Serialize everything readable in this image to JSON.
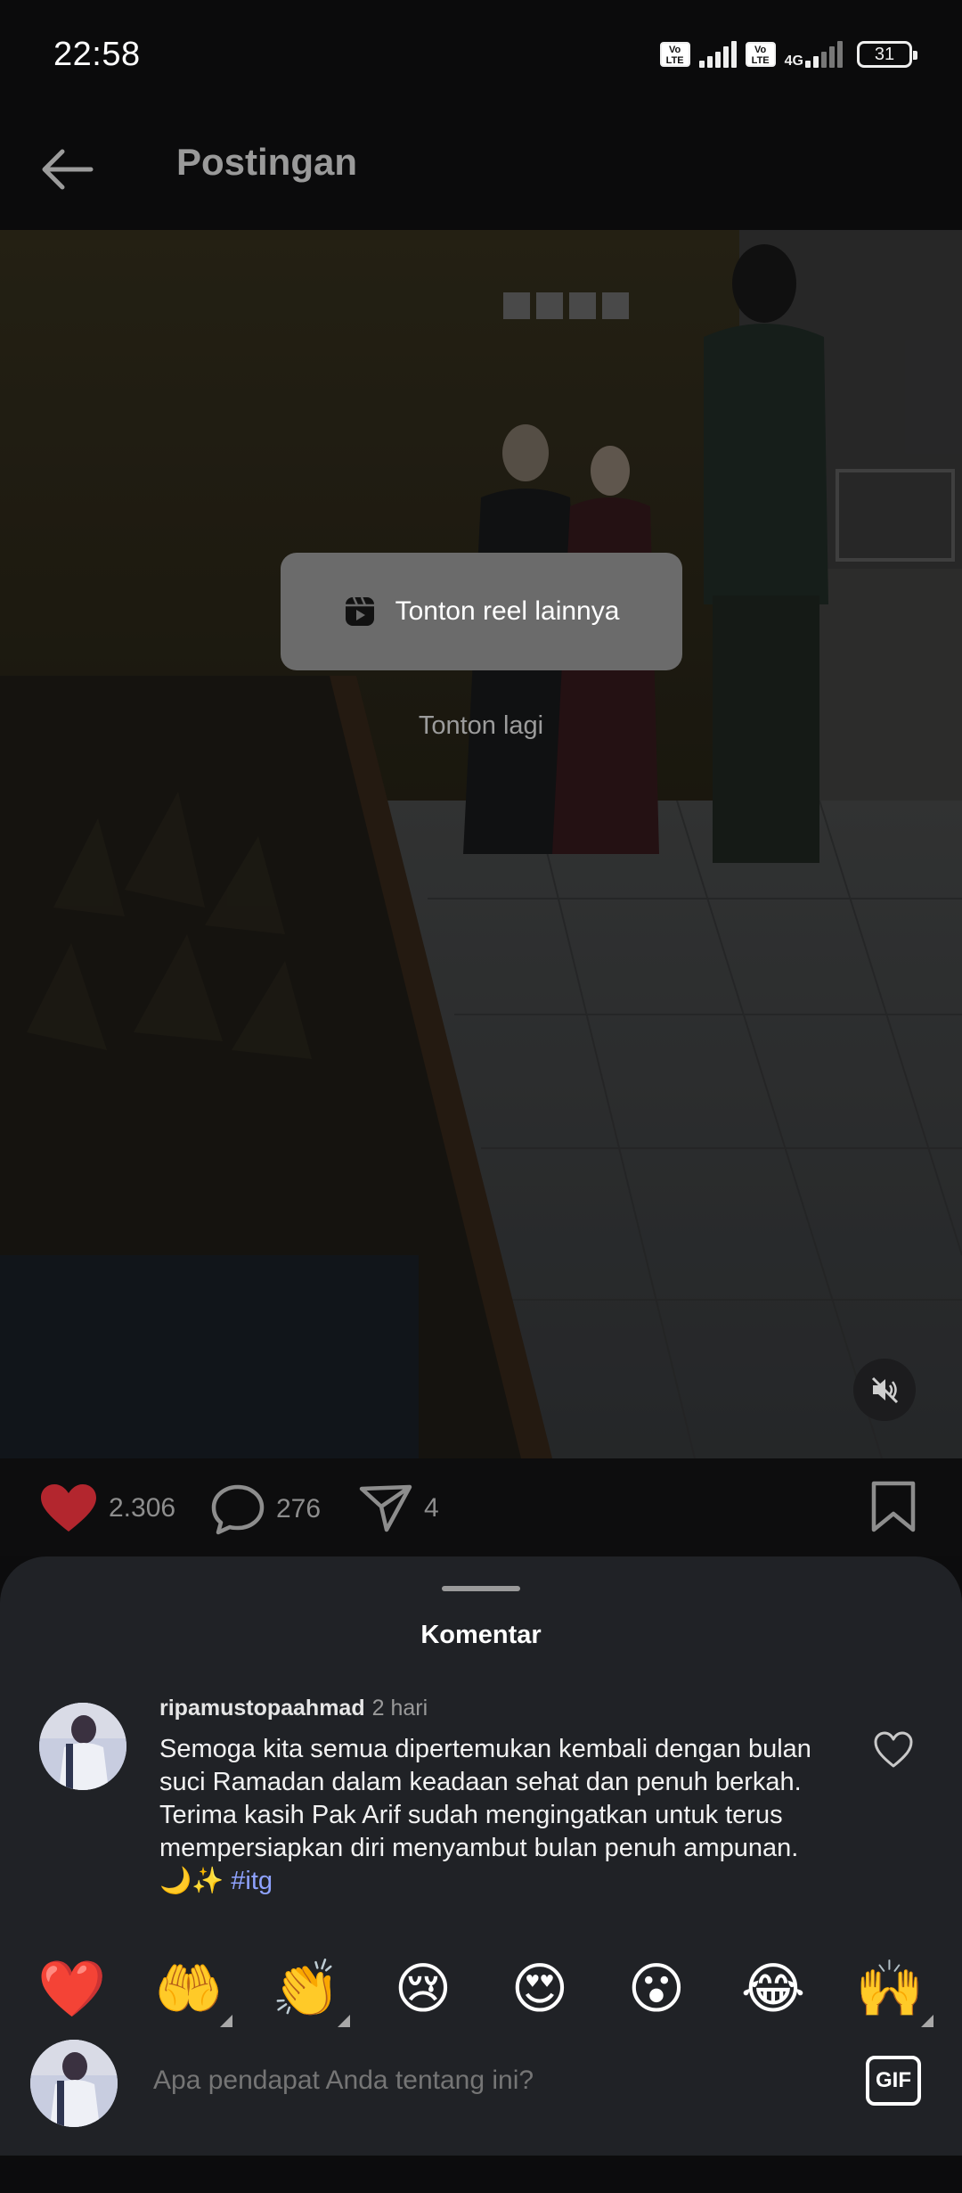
{
  "status_bar": {
    "time": "22:58",
    "volte_label": "Vo LTE",
    "network": "4G",
    "battery": "31"
  },
  "header": {
    "title": "Postingan",
    "back_icon": "arrow-left-icon"
  },
  "media": {
    "watch_more_reels": "Tonton reel lainnya",
    "reels_icon": "reels-icon",
    "watch_again": "Tonton lagi",
    "mute_icon": "speaker-muted-icon"
  },
  "actions": {
    "likes": "2.306",
    "comments": "276",
    "shares": "4",
    "liked": true,
    "heart_color": "#b3262e"
  },
  "comments_sheet": {
    "title": "Komentar",
    "comment": {
      "username": "ripamustopaahmad",
      "time": "2 hari",
      "text": "Semoga kita semua dipertemukan kembali dengan bulan suci Ramadan dalam keadaan sehat dan penuh berkah. Terima kasih Pak Arif sudah mengingatkan untuk terus mempersiapkan diri menyambut bulan penuh ampunan. 🌙✨",
      "hashtag": "#itg"
    },
    "reactions": [
      "❤️",
      "🤲",
      "👏",
      "😢",
      "😍",
      "😮",
      "😂",
      "🙌"
    ]
  },
  "input": {
    "placeholder": "Apa pendapat Anda tentang ini?",
    "gif_label": "GIF"
  }
}
